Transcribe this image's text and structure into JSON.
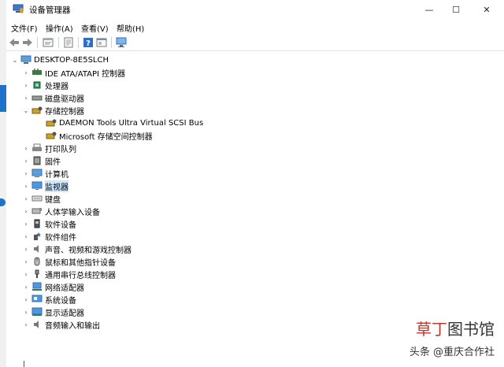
{
  "window": {
    "title": "设备管理器",
    "minimize": "—",
    "maximize": "☐",
    "close": "✕"
  },
  "menu": [
    "文件(F)",
    "操作(A)",
    "查看(V)",
    "帮助(H)"
  ],
  "toolbar": [
    "back-icon",
    "forward-icon",
    "properties-icon",
    "update-driver-icon",
    "help-icon",
    "view-icon",
    "monitor-scan-icon"
  ],
  "tree": {
    "root": "DESKTOP-8E5SLCH",
    "items": [
      {
        "label": "IDE ATA/ATAPI 控制器",
        "icon": "ide-controller-icon",
        "expanded": false
      },
      {
        "label": "处理器",
        "icon": "processor-icon",
        "expanded": false
      },
      {
        "label": "磁盘驱动器",
        "icon": "disk-drive-icon",
        "expanded": false
      },
      {
        "label": "存储控制器",
        "icon": "storage-controller-icon",
        "expanded": true,
        "children": [
          "DAEMON Tools Ultra Virtual SCSI Bus",
          "Microsoft 存储空间控制器"
        ]
      },
      {
        "label": "打印队列",
        "icon": "printer-icon",
        "expanded": false
      },
      {
        "label": "固件",
        "icon": "firmware-icon",
        "expanded": false
      },
      {
        "label": "计算机",
        "icon": "computer-icon",
        "expanded": false
      },
      {
        "label": "监视器",
        "icon": "monitor-icon",
        "expanded": false,
        "selected": true
      },
      {
        "label": "键盘",
        "icon": "keyboard-icon",
        "expanded": false
      },
      {
        "label": "人体学输入设备",
        "icon": "hid-icon",
        "expanded": false
      },
      {
        "label": "软件设备",
        "icon": "software-device-icon",
        "expanded": false
      },
      {
        "label": "软件组件",
        "icon": "software-component-icon",
        "expanded": false
      },
      {
        "label": "声音、视频和游戏控制器",
        "icon": "sound-icon",
        "expanded": false
      },
      {
        "label": "鼠标和其他指针设备",
        "icon": "mouse-icon",
        "expanded": false
      },
      {
        "label": "通用串行总线控制器",
        "icon": "usb-icon",
        "expanded": false
      },
      {
        "label": "网络适配器",
        "icon": "network-adapter-icon",
        "expanded": false
      },
      {
        "label": "系统设备",
        "icon": "system-device-icon",
        "expanded": false
      },
      {
        "label": "显示适配器",
        "icon": "display-adapter-icon",
        "expanded": false
      },
      {
        "label": "音频输入和输出",
        "icon": "audio-io-icon",
        "expanded": false
      }
    ]
  },
  "watermark": {
    "line1_a": "草丁",
    "line1_b": "图书馆",
    "line2": "头条 @重庆合作社"
  },
  "colors": {
    "selection": "#cce8ff",
    "accent": "#1e73c8"
  }
}
